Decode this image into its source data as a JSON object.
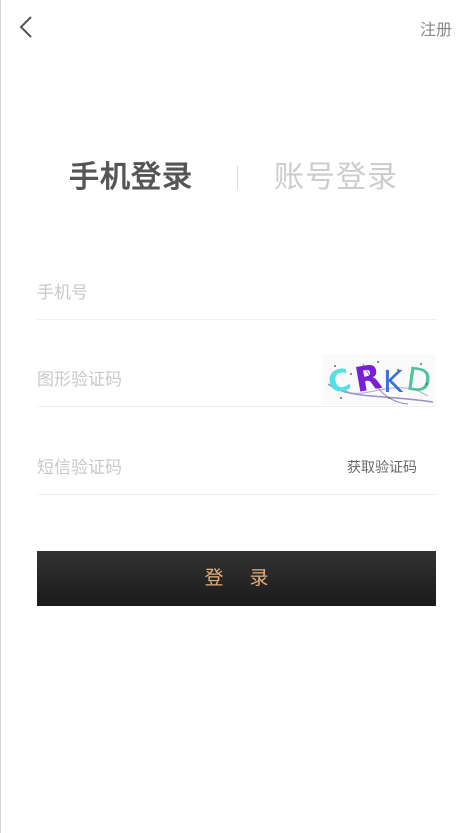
{
  "header": {
    "back_icon": "chevron-left-icon",
    "register_label": "注册"
  },
  "tabs": [
    {
      "label": "手机登录",
      "active": true
    },
    {
      "label": "账号登录",
      "active": false
    }
  ],
  "form": {
    "phone": {
      "placeholder": "手机号",
      "value": ""
    },
    "captcha": {
      "placeholder": "图形验证码",
      "value": "",
      "image_text": "RKD"
    },
    "sms": {
      "placeholder": "短信验证码",
      "value": "",
      "button_label": "获取验证码"
    }
  },
  "login_button": {
    "label": "登 录"
  },
  "colors": {
    "active_tab": "#555555",
    "inactive_tab": "#cccccc",
    "button_bg": "#222222",
    "button_text": "#e8b07a"
  }
}
